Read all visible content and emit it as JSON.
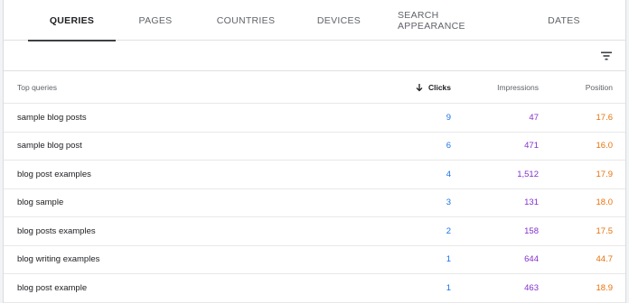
{
  "tabs": [
    {
      "label": "QUERIES",
      "active": true
    },
    {
      "label": "PAGES",
      "active": false
    },
    {
      "label": "COUNTRIES",
      "active": false
    },
    {
      "label": "DEVICES",
      "active": false
    },
    {
      "label": "SEARCH APPEARANCE",
      "active": false
    },
    {
      "label": "DATES",
      "active": false
    }
  ],
  "toolbar": {
    "filter_icon": "filter-icon"
  },
  "table": {
    "headers": {
      "query": "Top queries",
      "clicks": "Clicks",
      "impressions": "Impressions",
      "position": "Position"
    },
    "sort_icon": "arrow-down-icon",
    "rows": [
      {
        "query": "sample blog posts",
        "clicks": "9",
        "impressions": "47",
        "position": "17.6"
      },
      {
        "query": "sample blog post",
        "clicks": "6",
        "impressions": "471",
        "position": "16.0"
      },
      {
        "query": "blog post examples",
        "clicks": "4",
        "impressions": "1,512",
        "position": "17.9"
      },
      {
        "query": "blog sample",
        "clicks": "3",
        "impressions": "131",
        "position": "18.0"
      },
      {
        "query": "blog posts examples",
        "clicks": "2",
        "impressions": "158",
        "position": "17.5"
      },
      {
        "query": "blog writing examples",
        "clicks": "1",
        "impressions": "644",
        "position": "44.7"
      },
      {
        "query": "blog post example",
        "clicks": "1",
        "impressions": "463",
        "position": "18.9"
      }
    ]
  },
  "colors": {
    "clicks": "#1a73e8",
    "impressions": "#8430ce",
    "position": "#e8710a",
    "active_tab_indicator": "#3c4043"
  }
}
